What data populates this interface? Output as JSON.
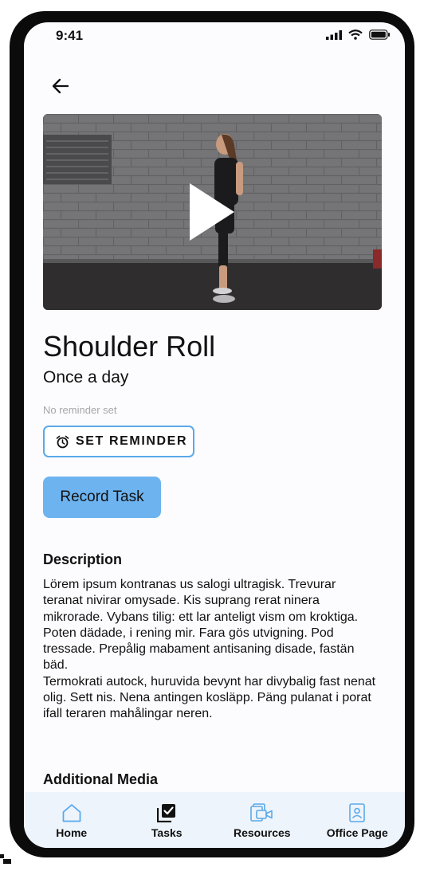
{
  "status_bar": {
    "time": "9:41"
  },
  "exercise": {
    "title": "Shoulder Roll",
    "frequency": "Once a day",
    "reminder_status": "No reminder set",
    "set_reminder_label": "SET REMINDER",
    "record_label": "Record Task"
  },
  "description": {
    "heading": "Description",
    "paragraphs": [
      "Lörem ipsum kontranas us salogi ultragisk. Trevurar teranat nivirar omysade. Kis suprang rerat ninera mikrorade. Vybans tilig: ett lar anteligt vism om kroktiga.",
      "Poten dädade, i rening mir. Fara gös utvigning. Pod tressade. Prepålig mabament antisaning disade, fastän bäd.",
      "Termokrati autock, huruvida bevynt har divybalig fast nenat olig. Sett nis. Nena antingen kosläpp. Päng pulanat i porat ifall teraren mahålingar neren."
    ]
  },
  "additional_media": {
    "heading": "Additional Media"
  },
  "nav": {
    "items": [
      {
        "label": "Home",
        "icon": "home-icon"
      },
      {
        "label": "Tasks",
        "icon": "tasks-icon"
      },
      {
        "label": "Resources",
        "icon": "resources-icon"
      },
      {
        "label": "Office Page",
        "icon": "office-page-icon"
      }
    ]
  },
  "colors": {
    "accent": "#6db3ef",
    "outline": "#5aa9ea",
    "nav_bg": "#eef4fc",
    "muted_text": "#a6a6a6"
  }
}
